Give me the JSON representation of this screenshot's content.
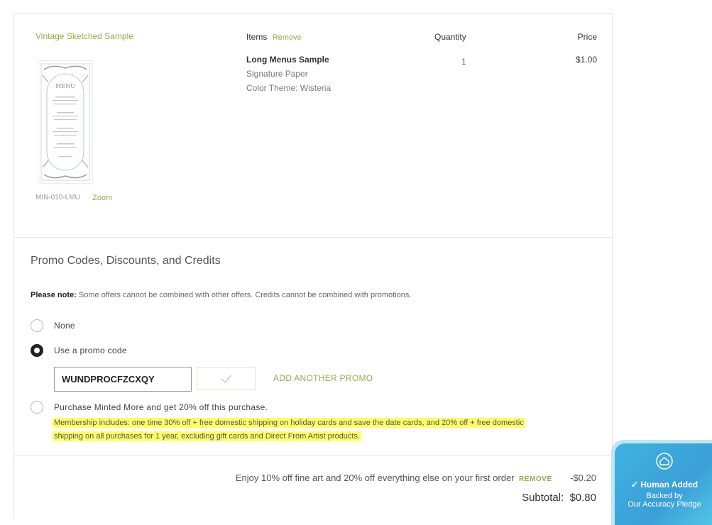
{
  "product": {
    "name": "Vintage Sketched Sample",
    "sku": "MIN-010-LMU",
    "zoom_label": "Zoom",
    "thumb_heading": "MENU"
  },
  "table": {
    "items_header": "Items",
    "remove_label": "Remove",
    "quantity_header": "Quantity",
    "price_header": "Price",
    "row": {
      "title": "Long Menus Sample",
      "paper": "Signature Paper",
      "color_theme": "Color Theme: Wisteria",
      "quantity": "1",
      "price": "$1.00"
    }
  },
  "promo": {
    "title": "Promo Codes, Discounts, and Credits",
    "note_bold": "Please note:",
    "note_text": " Some offers cannot be combined with other offers. Credits cannot be combined with promotions.",
    "options": {
      "none": "None",
      "use_code": "Use a promo code",
      "membership": "Purchase Minted More and get 20% off this purchase."
    },
    "code_value": "WUNDPROCFZCXQY",
    "add_another": "ADD ANOTHER PROMO",
    "membership_line1": "Membership includes: one time 30% off + free domestic shipping on holiday cards and save the date cards, and 20% off + free domestic",
    "membership_line2": "shipping on all purchases for 1 year, excluding gift cards and Direct From Artist products."
  },
  "summary": {
    "discount_text": "Enjoy 10% off fine art and 20% off everything else on your first order",
    "remove_label": "REMOVE",
    "discount_amount": "-$0.20",
    "subtotal_label": "Subtotal:",
    "subtotal_value": "$0.80"
  },
  "badge": {
    "title": "Human Added",
    "line1": "Backed by",
    "line2": "Our Accuracy Pledge"
  },
  "colors": {
    "accent": "#8fb04a",
    "highlight": "#ffff66",
    "badge": "#3fb3e2"
  }
}
